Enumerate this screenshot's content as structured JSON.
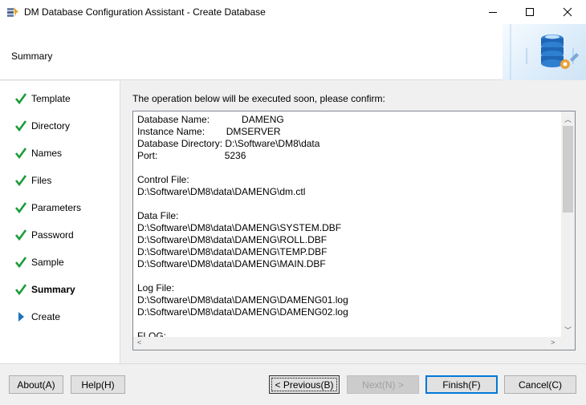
{
  "window": {
    "title": "DM Database Configuration Assistant - Create Database",
    "controls": [
      "minimize-icon",
      "maximize-icon",
      "close-icon"
    ]
  },
  "header": {
    "title": "Summary",
    "art": "database-gear-icon"
  },
  "sidebar": {
    "items": [
      {
        "label": "Template",
        "state": "done"
      },
      {
        "label": "Directory",
        "state": "done"
      },
      {
        "label": "Names",
        "state": "done"
      },
      {
        "label": "Files",
        "state": "done"
      },
      {
        "label": "Parameters",
        "state": "done"
      },
      {
        "label": "Password",
        "state": "done"
      },
      {
        "label": "Sample",
        "state": "done"
      },
      {
        "label": "Summary",
        "state": "current"
      },
      {
        "label": "Create",
        "state": "next"
      }
    ]
  },
  "main": {
    "prompt": "The operation below will be executed soon, please confirm:",
    "summary_text": "Database Name:            DAMENG\nInstance Name:        DMSERVER\nDatabase Directory: D:\\Software\\DM8\\data\nPort:                         5236\n\nControl File:\nD:\\Software\\DM8\\data\\DAMENG\\dm.ctl\n\nData File:\nD:\\Software\\DM8\\data\\DAMENG\\SYSTEM.DBF\nD:\\Software\\DM8\\data\\DAMENG\\ROLL.DBF\nD:\\Software\\DM8\\data\\DAMENG\\TEMP.DBF\nD:\\Software\\DM8\\data\\DAMENG\\MAIN.DBF\n\nLog File:\nD:\\Software\\DM8\\data\\DAMENG\\DAMENG01.log\nD:\\Software\\DM8\\data\\DAMENG\\DAMENG02.log\n\nFLOG:"
  },
  "buttons": {
    "about": "About(A)",
    "help": "Help(H)",
    "previous": "< Previous(B)",
    "next": "Next(N) >",
    "finish": "Finish(F)",
    "cancel": "Cancel(C)"
  },
  "colors": {
    "check": "#1a9c3a",
    "arrow": "#1e73be",
    "default_button_border": "#0078d7"
  }
}
